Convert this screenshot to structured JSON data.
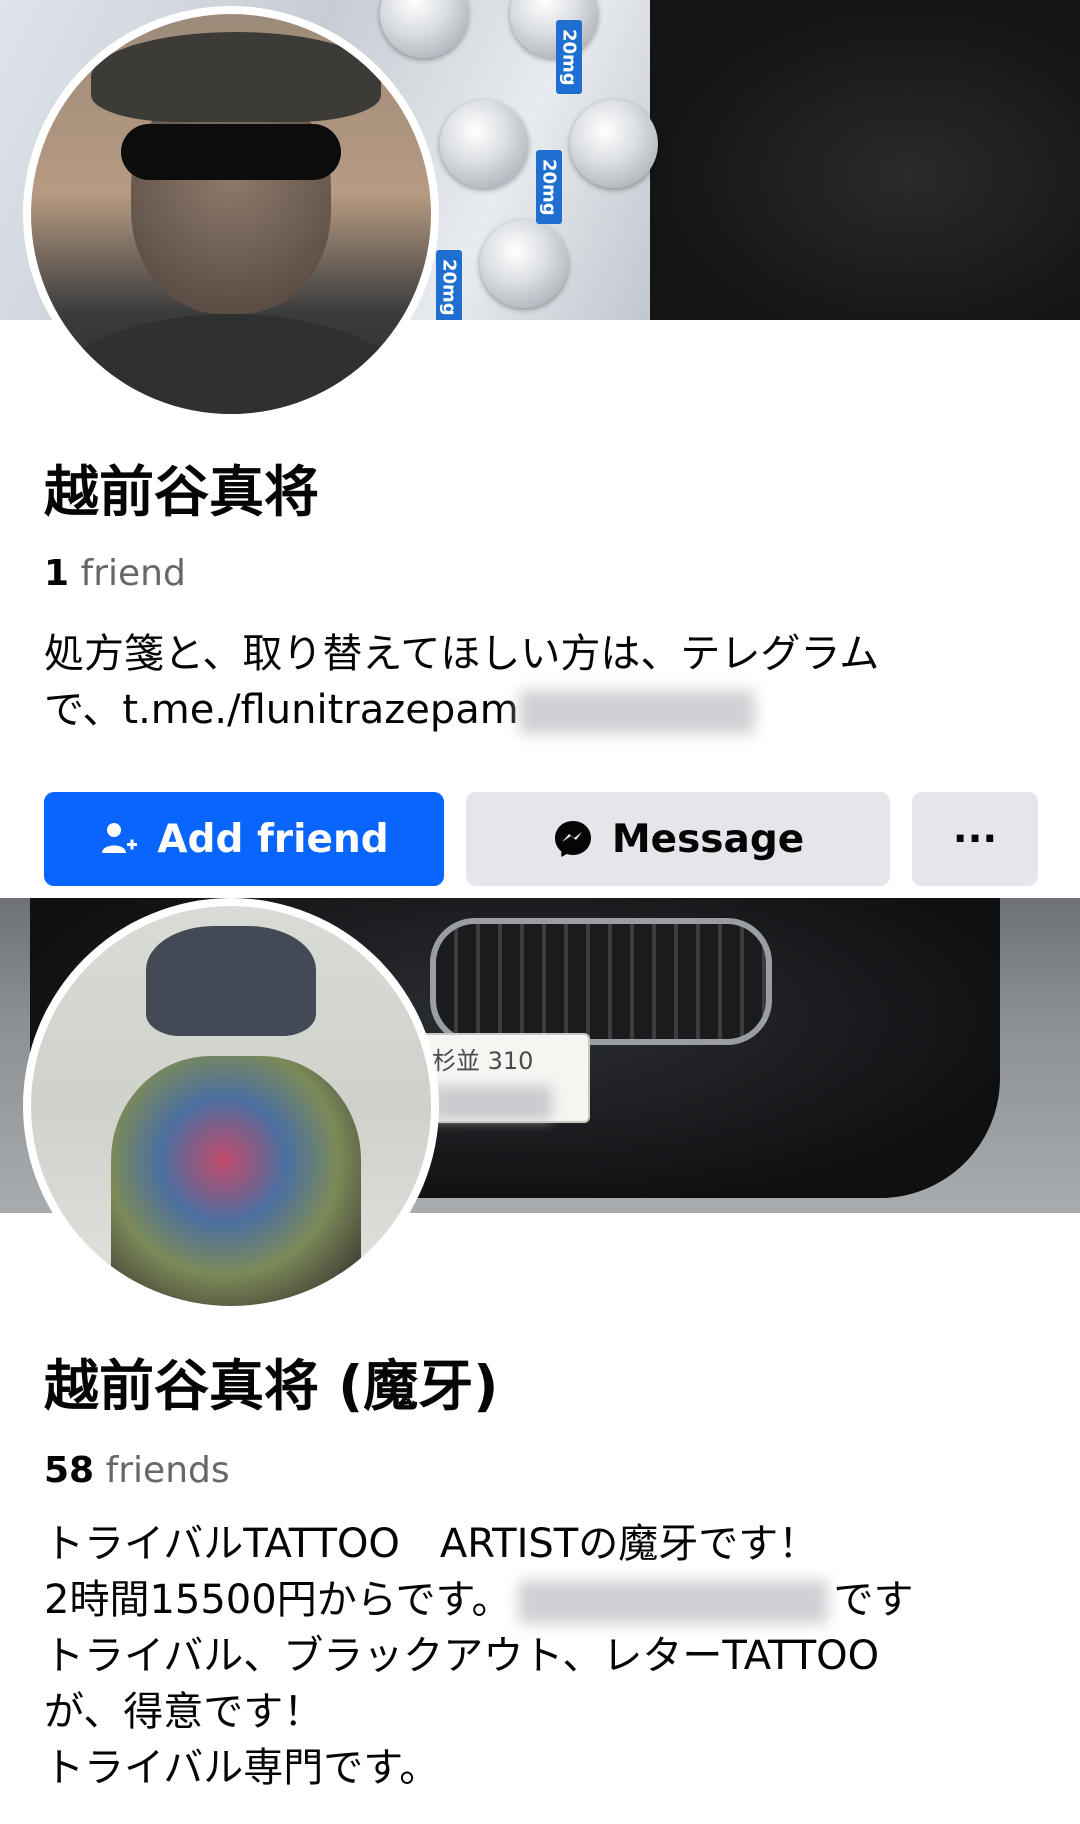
{
  "profiles": [
    {
      "name": "越前谷真将",
      "friends_count": "1",
      "friends_label": "friend",
      "bio_line1": "処方箋と、取り替えてほしい方は、テレグラム",
      "bio_line2": "で、t.me./flunitrazepam",
      "cover_labels": {
        "strip_1": "20mg",
        "strip_2": "20mg",
        "strip_3": "20mg"
      }
    },
    {
      "name": "越前谷真将 (魔牙)",
      "friends_count": "58",
      "friends_label": "friends",
      "bio_line1": "トライバルTATTOO　ARTISTの魔牙です！",
      "bio_line2_pre": "2時間15500円からです。",
      "bio_line2_post": "です",
      "bio_line3": "トライバル、ブラックアウト、レターTATTOO",
      "bio_line4": "が、得意です！",
      "bio_line5": "トライバル専門です。",
      "plate_text": "杉並 310"
    }
  ],
  "actions": {
    "add_friend_label": "Add friend",
    "message_label": "Message",
    "more_label": "···"
  },
  "colors": {
    "primary_button": "#0866ff",
    "secondary_button": "#e4e6eb",
    "secondary_text": "#65676b"
  },
  "icons": [
    "add-friend-icon",
    "messenger-icon",
    "more-icon"
  ]
}
